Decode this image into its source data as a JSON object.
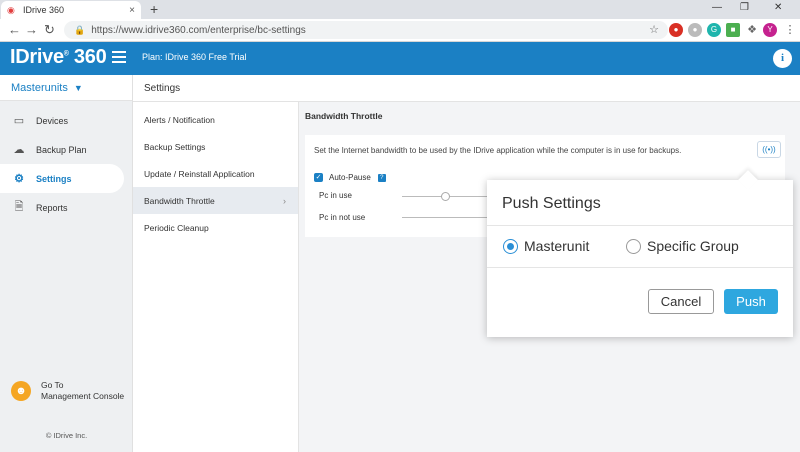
{
  "browser": {
    "tab_title": "IDrive 360",
    "tab_close": "×",
    "new_tab": "+",
    "url": "https://www.idrive360.com/enterprise/bc-settings",
    "profile_initial": "Y"
  },
  "header": {
    "logo": "IDrive",
    "logo_suffix": "360",
    "plan_label": "Plan: IDrive 360 Free Trial",
    "info": "i",
    "brand_color": "#1b80c4"
  },
  "sidebar": {
    "org": "Masterunits",
    "items": [
      {
        "label": "Devices",
        "icon": "monitor-icon"
      },
      {
        "label": "Backup Plan",
        "icon": "cloud-upload-icon"
      },
      {
        "label": "Settings",
        "icon": "gear-icon"
      },
      {
        "label": "Reports",
        "icon": "document-icon"
      }
    ],
    "console_line1": "Go To",
    "console_line2": "Management Console",
    "copyright": "© IDrive Inc."
  },
  "breadcrumb": "Settings",
  "submenu": [
    "Alerts / Notification",
    "Backup Settings",
    "Update / Reinstall Application",
    "Bandwidth Throttle",
    "Periodic Cleanup"
  ],
  "content": {
    "title": "Bandwidth Throttle",
    "description": "Set the Internet bandwidth to be used by the IDrive application while the computer is in use for backups.",
    "auto_pause": "Auto-Pause",
    "help": "?",
    "pc_in_use": "Pc in use",
    "pc_not_in_use": "Pc in not use"
  },
  "popover": {
    "title": "Push Settings",
    "option1": "Masterunit",
    "option2": "Specific Group",
    "cancel": "Cancel",
    "push": "Push"
  }
}
